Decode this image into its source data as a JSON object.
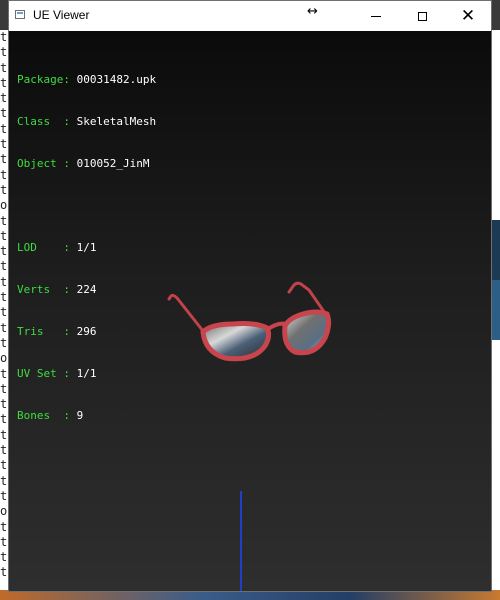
{
  "window": {
    "title": "UE Viewer",
    "controls": {
      "minimize": "minimize",
      "maximize": "maximize",
      "close": "close"
    }
  },
  "info": {
    "package": {
      "label": "Package:",
      "value": "00031482.upk"
    },
    "class": {
      "label": "Class  :",
      "value": "SkeletalMesh"
    },
    "object": {
      "label": "Object :",
      "value": "010052_JinM"
    },
    "lod": {
      "label": "LOD    :",
      "value": "1/1"
    },
    "verts": {
      "label": "Verts  :",
      "value": "224"
    },
    "tris": {
      "label": "Tris   :",
      "value": "296"
    },
    "uvset": {
      "label": "UV Set :",
      "value": "1/1"
    },
    "bones": {
      "label": "Bones  :",
      "value": "9"
    }
  },
  "background": {
    "left_strip_text": "t\nt\nt\nt\nt\nt\nt\nt\nt\nt\nt\no\nt\nt\nt\nt\nt\nt\nt\nt\nt\no\nt\nt\nt\nt\nt\nt\nt\nt\nt\no\nt\nt\nt\nt"
  },
  "colors": {
    "label_green": "#3fdc3f",
    "value_white": "#ffffff",
    "axis_blue": "#1f3fc9",
    "frame_red": "#c0424a"
  }
}
